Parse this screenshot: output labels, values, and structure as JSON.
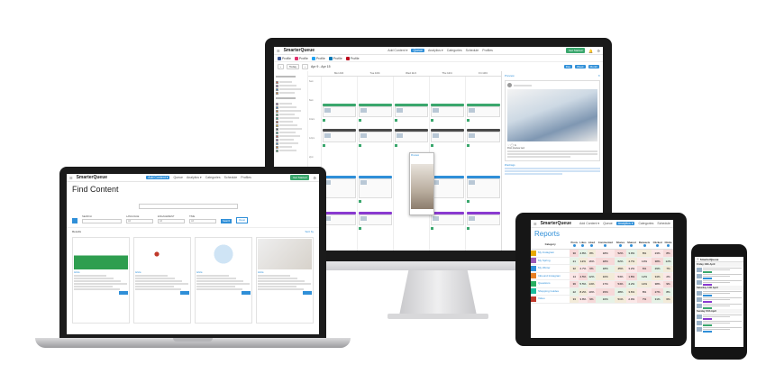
{
  "brand": {
    "logo": "SmarterQueue",
    "blue": "#2f8fd8",
    "green": "#3aa76d"
  },
  "imac": {
    "nav": [
      "Add Content ▾",
      "Queue",
      "Analytics ▾",
      "Categories",
      "Schedule",
      "Profiles"
    ],
    "active_nav": "Queue",
    "cta": "Get Started",
    "accounts": [
      {
        "name": "Profile",
        "color": "#3b5998"
      },
      {
        "name": "Profile",
        "color": "#e1306c"
      },
      {
        "name": "Profile",
        "color": "#1da1f2"
      },
      {
        "name": "Profile",
        "color": "#0077b5"
      },
      {
        "name": "Profile",
        "color": "#bd081c"
      }
    ],
    "toolbar": {
      "today": "Today",
      "range": "Apr 9 - Apr 15",
      "views": [
        "Day",
        "Week",
        "Month"
      ]
    },
    "days": [
      "Mon 9/4",
      "Tue 10/4",
      "Wed 11/4",
      "Thu 12/4",
      "Fri 13/4"
    ],
    "times": [
      "6am",
      "8am",
      "10am",
      "12pm",
      "2pm",
      "4pm",
      "6pm",
      "8pm",
      "10pm"
    ],
    "event_colors": [
      "#3aa76d",
      "#4a4a4a",
      "#2f8fd8",
      "#8a3ad0"
    ],
    "popup_text": "Preview",
    "preview": {
      "header": "Preview",
      "body": "Post preview text",
      "tags": "#hashtags"
    }
  },
  "laptop": {
    "nav": [
      "Add Content ▾",
      "Queue",
      "Analytics ▾",
      "Categories",
      "Schedule",
      "Profiles"
    ],
    "active_nav": "Add Content ▾",
    "cta": "Get Started",
    "title": "Find Content",
    "search_placeholder": "",
    "filters": [
      {
        "label": "SEARCH",
        "value": ""
      },
      {
        "label": "LANGUAGE",
        "value": "All"
      },
      {
        "label": "ENGAGEMENT",
        "value": "All"
      },
      {
        "label": "TIME",
        "value": "All"
      }
    ],
    "search_button": "Search",
    "reset_button": "Reset",
    "results_label": "Results",
    "sort_label": "Sort by",
    "cards": [
      {
        "img": "chart",
        "caption": "Article"
      },
      {
        "img": "diagram",
        "caption": "Article"
      },
      {
        "img": "illustration",
        "caption": "Article"
      },
      {
        "img": "photo",
        "caption": "Article"
      }
    ]
  },
  "tablet": {
    "nav": [
      "Add Content ▾",
      "Queue",
      "Analytics ▾",
      "Categories",
      "Schedule"
    ],
    "active_nav": "Analytics ▾",
    "title": "Reports",
    "columns": [
      "Category",
      "Posts",
      "Likes",
      "Liked",
      "Commented",
      "Shares",
      "Shared",
      "Retweets",
      "Clicked",
      "Clicks"
    ],
    "rows": [
      {
        "name": "My Instagram",
        "color": "#e8a800",
        "values": [
          "30",
          "4.8%",
          "8%",
          "18%",
          "52%",
          "3.9%",
          "8%",
          "23%",
          "8%"
        ]
      },
      {
        "name": "My Spring",
        "color": "#9b59b6",
        "values": [
          "21",
          "12%",
          "16%",
          "18%",
          "62%",
          "4.7%",
          "10%",
          "38%",
          "12%"
        ]
      },
      {
        "name": "My Winter",
        "color": "#2f8fd8",
        "values": [
          "32",
          "2.7%",
          "6%",
          "18%",
          "45%",
          "3.2%",
          "6%",
          "29%",
          "7%"
        ]
      },
      {
        "name": "Inbound Instagram",
        "color": "#e67e22",
        "values": [
          "14",
          "4.5%",
          "12%",
          "10%",
          "54%",
          "1.8%",
          "12%",
          "34%",
          "2%"
        ]
      },
      {
        "name": "Questions",
        "color": "#27ae60",
        "values": [
          "36",
          "5.5%",
          "14%",
          "17%",
          "54%",
          "4.2%",
          "14%",
          "38%",
          "9%"
        ]
      },
      {
        "name": "Shopping Guides",
        "color": "#1abc9c",
        "values": [
          "22",
          "8.2%",
          "10%",
          "15%",
          "48%",
          "3.6%",
          "8%",
          "27%",
          "8%"
        ]
      },
      {
        "name": "Video",
        "color": "#c0392b",
        "values": [
          "33",
          "3.8%",
          "9%",
          "16%",
          "51%",
          "2.9%",
          "7%",
          "31%",
          "6%"
        ]
      }
    ],
    "heat": [
      "#f6d9d9",
      "#e6f2e6",
      "#f3ebd9",
      "#fbe7e7"
    ]
  },
  "phone": {
    "days": [
      "Friday 13th April",
      "Saturday 14th April",
      "Sunday 15th April"
    ],
    "chips": [
      "#3aa76d",
      "#2f8fd8",
      "#8a3ad0"
    ]
  }
}
